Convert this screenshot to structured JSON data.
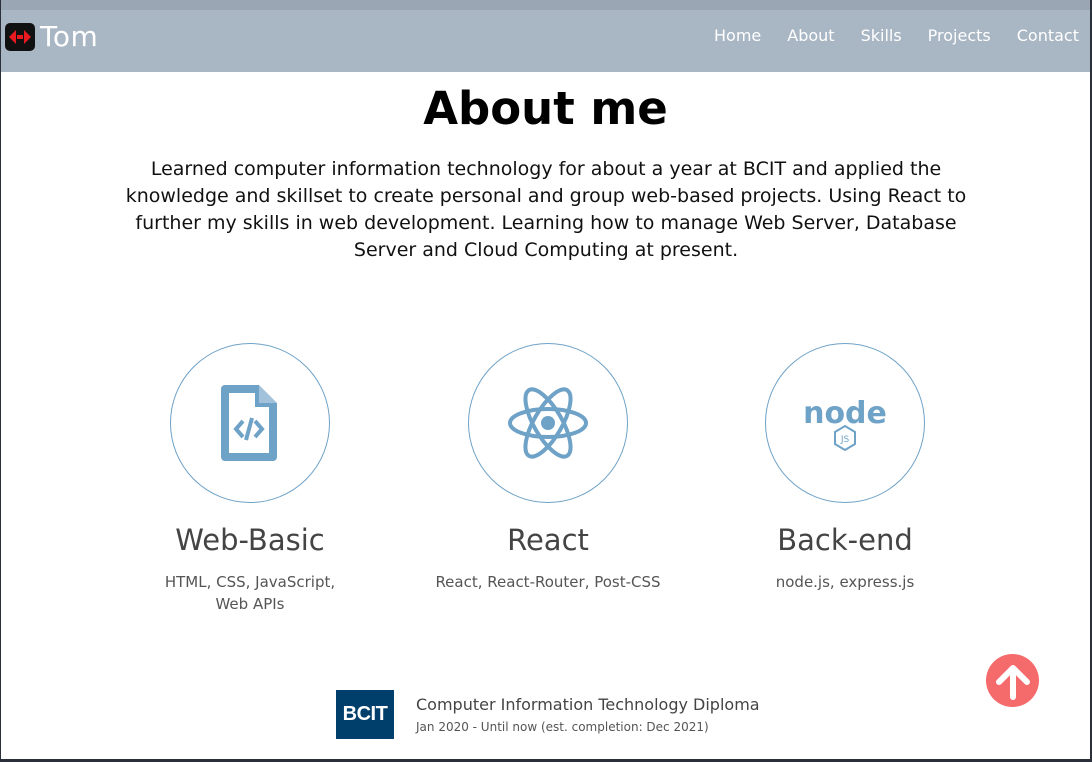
{
  "nav": {
    "brand_name": "Tom",
    "links": [
      "Home",
      "About",
      "Skills",
      "Projects",
      "Contact"
    ]
  },
  "about": {
    "title": "About me",
    "intro": "Learned computer information technology for about a year at BCIT and applied the knowledge and skillset to create personal and group web-based projects. Using React to further my skills in web development. Learning how to manage Web Server, Database Server and Cloud Computing at present."
  },
  "skills": [
    {
      "icon": "code-file-icon",
      "title": "Web-Basic",
      "desc": "HTML, CSS, JavaScript, Web APIs"
    },
    {
      "icon": "react-icon",
      "title": "React",
      "desc": "React, React-Router, Post-CSS"
    },
    {
      "icon": "nodejs-icon",
      "title": "Back-end",
      "desc": "node.js, express.js"
    }
  ],
  "education": {
    "logo_text": "BCIT",
    "title": "Computer Information Technology Diploma",
    "dates": "Jan 2020 - Until now (est. completion: Dec 2021)"
  },
  "scroll_top_icon": "arrow-up-icon",
  "colors": {
    "navbar": "#a9b6c4",
    "accent": "#6fa2c7",
    "scroll_button": "#f56a6a",
    "bcit_blue": "#003e6b"
  }
}
